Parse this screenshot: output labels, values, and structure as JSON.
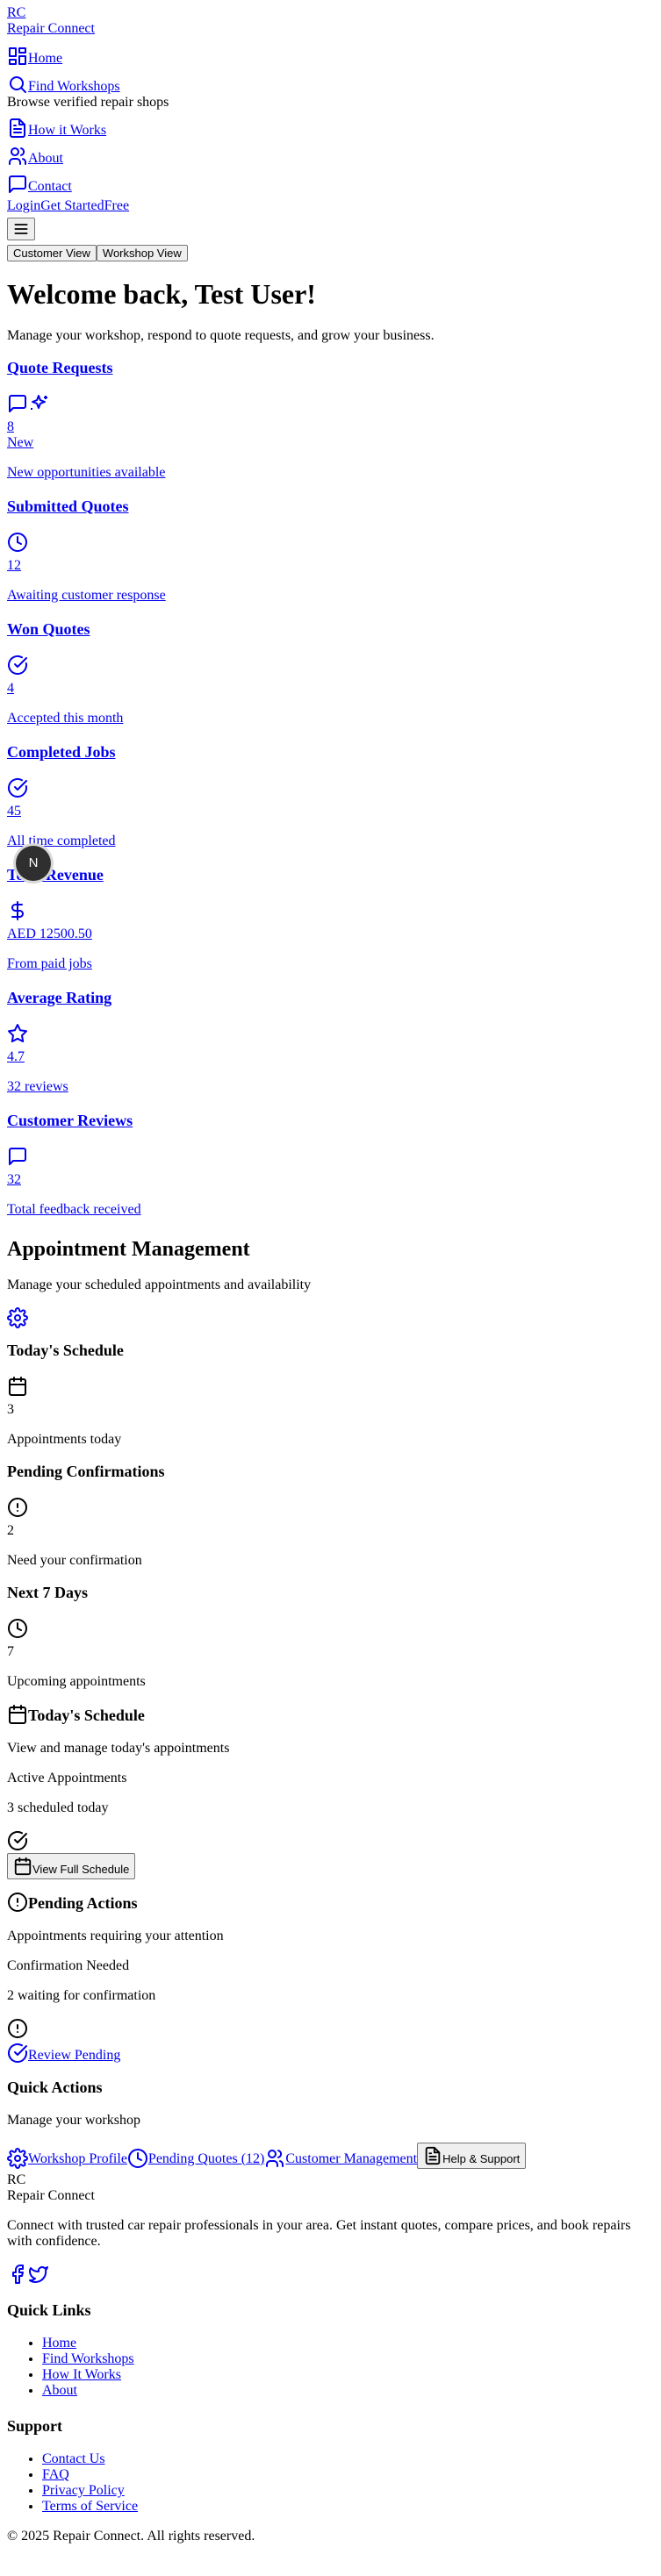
{
  "nav": {
    "logo_short": "RC",
    "brand": "Repair Connect",
    "home": "Home",
    "find_workshops": "Find Workshops",
    "find_workshops_desc": "Browse verified repair shops",
    "how_it_works": "How it Works",
    "about": "About",
    "contact": "Contact",
    "login": "Login",
    "get_started": "Get Started",
    "free": "Free",
    "customer_view": "Customer View",
    "workshop_view": "Workshop View"
  },
  "hero": {
    "title": "Welcome back, Test User!",
    "subtitle": "Manage your workshop, respond to quote requests, and grow your business."
  },
  "stats": [
    {
      "title": "Quote Requests",
      "value": "8",
      "badge": "New",
      "sub": "New opportunities available",
      "icon": "message-square-icon"
    },
    {
      "title": "Submitted Quotes",
      "value": "12",
      "sub": "Awaiting customer response",
      "icon": "clock-icon"
    },
    {
      "title": "Won Quotes",
      "value": "4",
      "sub": "Accepted this month",
      "icon": "check-circle-icon"
    },
    {
      "title": "Completed Jobs",
      "value": "45",
      "sub": "All time completed",
      "icon": "check-circle-icon"
    },
    {
      "title": "Total Revenue",
      "value": "AED 12500.50",
      "sub": "From paid jobs",
      "icon": "dollar-sign-icon"
    },
    {
      "title": "Average Rating",
      "value": "4.7",
      "sub": "32 reviews",
      "icon": "star-icon"
    },
    {
      "title": "Customer Reviews",
      "value": "32",
      "sub": "Total feedback received",
      "icon": "message-square-icon"
    }
  ],
  "appointments": {
    "title": "Appointment Management",
    "subtitle": "Manage your scheduled appointments and availability",
    "cards": [
      {
        "title": "Today's Schedule",
        "value": "3",
        "sub": "Appointments today"
      },
      {
        "title": "Pending Confirmations",
        "value": "2",
        "sub": "Need your confirmation"
      },
      {
        "title": "Next 7 Days",
        "value": "7",
        "sub": "Upcoming appointments"
      }
    ]
  },
  "today_schedule": {
    "title": "Today's Schedule",
    "desc": "View and manage today's appointments",
    "label": "Active Appointments",
    "count_text": "3 scheduled today",
    "button": "View Full Schedule"
  },
  "pending_actions": {
    "title": "Pending Actions",
    "desc": "Appointments requiring your attention",
    "label": "Confirmation Needed",
    "count_text": "2 waiting for confirmation",
    "link": "Review Pending"
  },
  "quick_actions": {
    "title": "Quick Actions",
    "subtitle": "Manage your workshop",
    "workshop_profile": "Workshop Profile",
    "pending_quotes": "Pending Quotes (12)",
    "customer_management": "Customer Management",
    "help_support": "Help & Support"
  },
  "footer": {
    "logo_short": "RC",
    "brand": "Repair Connect",
    "tagline": "Connect with trusted car repair professionals in your area. Get instant quotes, compare prices, and book repairs with confidence.",
    "quick_links_title": "Quick Links",
    "quick_links": [
      "Home",
      "Find Workshops",
      "How It Works",
      "About"
    ],
    "support_title": "Support",
    "support_links": [
      "Contact Us",
      "FAQ",
      "Privacy Policy",
      "Terms of Service"
    ],
    "copyright": "© 2025 Repair Connect. All rights reserved."
  },
  "avatar": {
    "initial": "N"
  },
  "colors": {
    "link": "#0000ee",
    "avatar_bg": "#2f2f2f"
  }
}
